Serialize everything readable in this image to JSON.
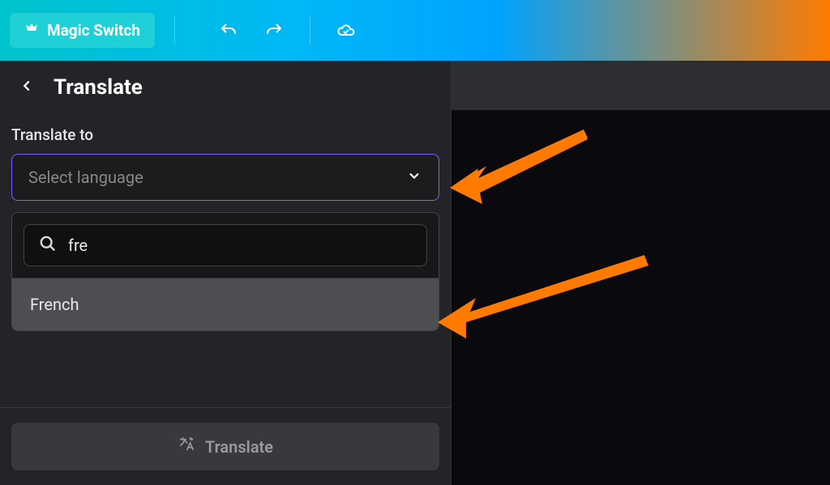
{
  "header": {
    "magic_switch_label": "Magic Switch"
  },
  "panel": {
    "title": "Translate",
    "field_label": "Translate to",
    "select_placeholder": "Select language",
    "search_value": "fre",
    "dropdown_option": "French",
    "action_label": "Translate"
  }
}
